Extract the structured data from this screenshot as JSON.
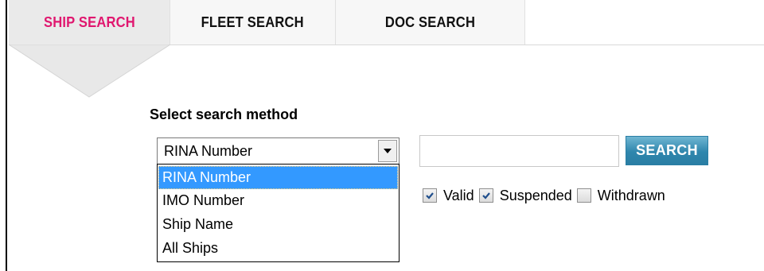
{
  "tabs": [
    {
      "label": "SHIP SEARCH",
      "active": true
    },
    {
      "label": "FLEET SEARCH",
      "active": false
    },
    {
      "label": "DOC SEARCH",
      "active": false
    }
  ],
  "colors": {
    "active_tab_text": "#e0176f",
    "selection_highlight": "#3399ff",
    "search_button": "#2f86ad"
  },
  "search": {
    "method_label": "Select search method",
    "selected_method": "RINA Number",
    "options": [
      "RINA Number",
      "IMO Number",
      "Ship Name",
      "All Ships"
    ],
    "input_value": "",
    "button_label": "SEARCH"
  },
  "status_filters": [
    {
      "label": "Valid",
      "checked": true
    },
    {
      "label": "Suspended",
      "checked": true
    },
    {
      "label": "Withdrawn",
      "checked": false
    }
  ],
  "icons": {
    "dropdown": "chevron-down-icon",
    "check": "checkmark-icon"
  }
}
